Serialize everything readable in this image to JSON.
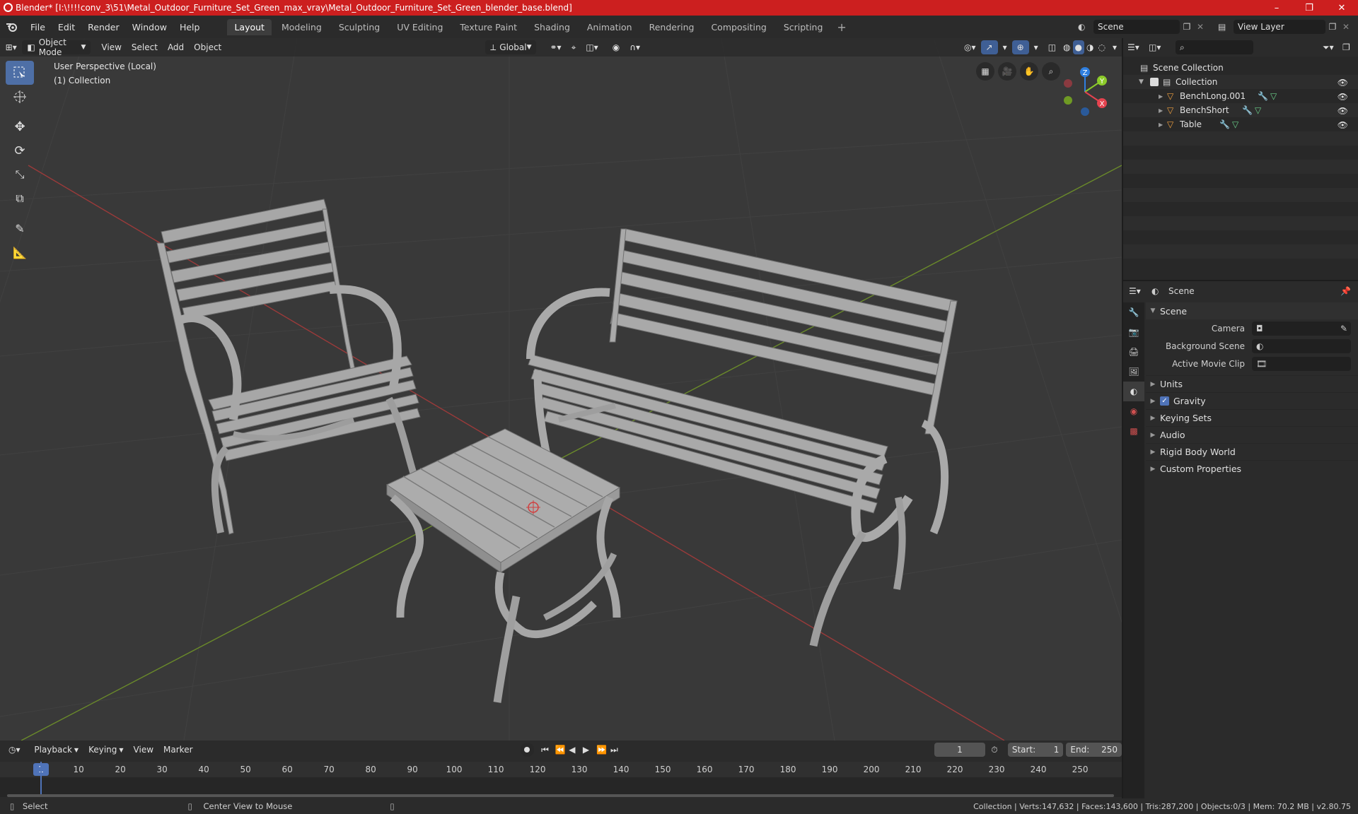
{
  "window": {
    "title": "Blender* [I:\\!!!!conv_3\\51\\Metal_Outdoor_Furniture_Set_Green_max_vray\\Metal_Outdoor_Furniture_Set_Green_blender_base.blend]",
    "minimize": "–",
    "maximize": "❐",
    "close": "✕"
  },
  "menu": {
    "items": [
      "File",
      "Edit",
      "Render",
      "Window",
      "Help"
    ],
    "workspaces": [
      "Layout",
      "Modeling",
      "Sculpting",
      "UV Editing",
      "Texture Paint",
      "Shading",
      "Animation",
      "Rendering",
      "Compositing",
      "Scripting"
    ],
    "active_workspace": "Layout",
    "add_tab": "+",
    "scene_name": "Scene",
    "view_layer": "View Layer"
  },
  "viewport": {
    "mode": "Object Mode",
    "menus": [
      "View",
      "Select",
      "Add",
      "Object"
    ],
    "orientation": "Global",
    "perspective_label": "User Perspective (Local)",
    "collection_label": "(1) Collection",
    "axes": {
      "x": "X",
      "y": "Y",
      "z": "Z"
    }
  },
  "outliner": {
    "root": "Scene Collection",
    "collection": "Collection",
    "objects": [
      {
        "name": "BenchLong.001"
      },
      {
        "name": "BenchShort"
      },
      {
        "name": "Table"
      }
    ]
  },
  "properties": {
    "header": "Scene",
    "panel": "Scene",
    "fields": [
      {
        "label": "Camera",
        "value": ""
      },
      {
        "label": "Background Scene",
        "value": ""
      },
      {
        "label": "Active Movie Clip",
        "value": ""
      }
    ],
    "subpanels": [
      "Units",
      "Gravity",
      "Keying Sets",
      "Audio",
      "Rigid Body World",
      "Custom Properties"
    ]
  },
  "timeline": {
    "menus": [
      "Playback",
      "Keying",
      "View",
      "Marker"
    ],
    "current_frame": "1",
    "start_label": "Start:",
    "start": "1",
    "end_label": "End:",
    "end": "250",
    "ticks": [
      "1",
      "10",
      "20",
      "30",
      "40",
      "50",
      "60",
      "70",
      "80",
      "90",
      "100",
      "110",
      "120",
      "130",
      "140",
      "150",
      "160",
      "170",
      "180",
      "190",
      "200",
      "210",
      "220",
      "230",
      "240",
      "250"
    ]
  },
  "status": {
    "select": "Select",
    "center": "Center View to Mouse",
    "stats": "Collection | Verts:147,632 | Faces:143,600 | Tris:287,200 | Objects:0/3 | Mem: 70.2 MB | v2.80.75"
  },
  "colors": {
    "title_bar": "#cc1f1f",
    "accent": "#4f73b8",
    "viewport_bg": "#393939",
    "axis_x": "#e5434f",
    "axis_y": "#8ccb2a",
    "axis_z": "#2f7fe0"
  }
}
